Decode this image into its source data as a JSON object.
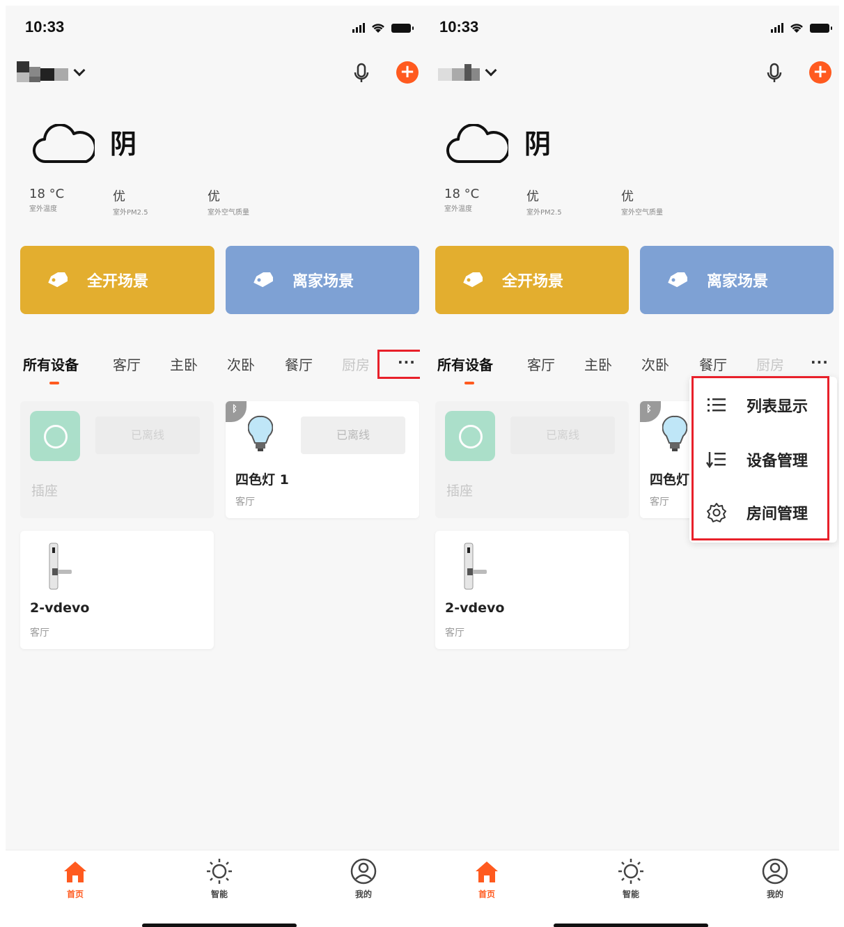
{
  "status": {
    "time": "10:33"
  },
  "weather": {
    "condition": "阴",
    "stats": [
      {
        "value": "18 °C",
        "label": "室外温度"
      },
      {
        "value": "优",
        "label": "室外PM2.5"
      },
      {
        "value": "优",
        "label": "室外空气质量"
      }
    ]
  },
  "scenes": [
    {
      "label": "全开场景",
      "color": "#e3ae2f"
    },
    {
      "label": "离家场景",
      "color": "#7ea1d4"
    }
  ],
  "tabs": [
    "所有设备",
    "客厅",
    "主卧",
    "次卧",
    "餐厅",
    "厨房"
  ],
  "more_label": "···",
  "devices": {
    "socket": {
      "name": "插座",
      "status": "已离线"
    },
    "bulb": {
      "name": "四色灯 1",
      "name_clipped": "四色灯",
      "room": "客厅",
      "status": "已离线",
      "badge": "ᛒ"
    },
    "lock": {
      "name": "2-vdevo",
      "room": "客厅"
    }
  },
  "menu": [
    {
      "label": "列表显示",
      "icon": "list-icon"
    },
    {
      "label": "设备管理",
      "icon": "sort-list-icon"
    },
    {
      "label": "房间管理",
      "icon": "gear-icon"
    }
  ],
  "tabbar": [
    {
      "label": "首页",
      "icon": "home-icon"
    },
    {
      "label": "智能",
      "icon": "sun-icon"
    },
    {
      "label": "我的",
      "icon": "user-icon"
    }
  ],
  "colors": {
    "accent": "#ff5a1f",
    "highlight": "#e8202a"
  }
}
